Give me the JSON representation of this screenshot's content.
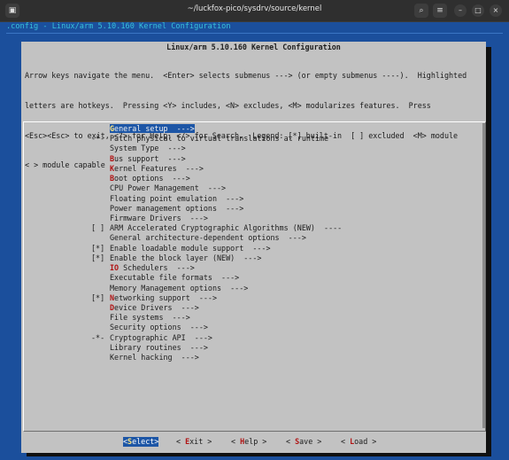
{
  "window": {
    "title": "~/luckfox-pico/sysdrv/source/kernel",
    "icons": [
      "terminal-icon",
      "search-icon",
      "menu-icon",
      "minimize-icon",
      "maximize-icon",
      "close-icon"
    ]
  },
  "terminal": {
    "config_header": ".config - Linux/arm 5.10.160 Kernel Configuration",
    "dialog_title": "Linux/arm 5.10.160 Kernel Configuration",
    "help_lines": [
      "Arrow keys navigate the menu.  <Enter> selects submenus ---> (or empty submenus ----).  Highlighted",
      "letters are hotkeys.  Pressing <Y> includes, <N> excludes, <M> modularizes features.  Press",
      "<Esc><Esc> to exit, <?> for Help, </> for Search.  Legend: [*] built-in  [ ] excluded  <M> module",
      "< > module capable"
    ],
    "menu": [
      {
        "prefix": "",
        "hotkey": "G",
        "rest": "eneral setup  --->",
        "selected": true
      },
      {
        "prefix": "-*-",
        "hotkey": "",
        "rest": "Patch physical to virtual translations at runtime"
      },
      {
        "prefix": "",
        "hotkey": "",
        "rest": "System Type  --->"
      },
      {
        "prefix": "",
        "hotkey": "B",
        "rest": "us support  --->"
      },
      {
        "prefix": "",
        "hotkey": "K",
        "rest": "ernel Features  --->"
      },
      {
        "prefix": "",
        "hotkey": "B",
        "rest": "oot options  --->"
      },
      {
        "prefix": "",
        "hotkey": "",
        "rest": "CPU Power Management  --->"
      },
      {
        "prefix": "",
        "hotkey": "",
        "rest": "Floating point emulation  --->"
      },
      {
        "prefix": "",
        "hotkey": "",
        "rest": "Power management options  --->"
      },
      {
        "prefix": "",
        "hotkey": "",
        "rest": "Firmware Drivers  --->"
      },
      {
        "prefix": "[ ]",
        "hotkey": "",
        "rest": "ARM Accelerated Cryptographic Algorithms (NEW)  ----"
      },
      {
        "prefix": "",
        "hotkey": "",
        "rest": "General architecture-dependent options  --->"
      },
      {
        "prefix": "[*]",
        "hotkey": "",
        "rest": "Enable loadable module support  --->"
      },
      {
        "prefix": "[*]",
        "hotkey": "",
        "rest": "Enable the block layer (NEW)  --->"
      },
      {
        "prefix": "",
        "hotkey": "IO",
        "rest": " Schedulers  --->"
      },
      {
        "prefix": "",
        "hotkey": "",
        "rest": "Executable file formats  --->"
      },
      {
        "prefix": "",
        "hotkey": "",
        "rest": "Memory Management options  --->"
      },
      {
        "prefix": "[*]",
        "hotkey": "N",
        "rest": "etworking support  --->"
      },
      {
        "prefix": "",
        "hotkey": "D",
        "rest": "evice Drivers  --->"
      },
      {
        "prefix": "",
        "hotkey": "",
        "rest": "File systems  --->"
      },
      {
        "prefix": "",
        "hotkey": "",
        "rest": "Security options  --->"
      },
      {
        "prefix": "-*-",
        "hotkey": "",
        "rest": "Cryptographic API  --->"
      },
      {
        "prefix": "",
        "hotkey": "",
        "rest": "Library routines  --->"
      },
      {
        "prefix": "",
        "hotkey": "",
        "rest": "Kernel hacking  --->"
      }
    ],
    "buttons": [
      {
        "pre": "<",
        "hotkey": "S",
        "post": "elect>",
        "active": true
      },
      {
        "pre": "< ",
        "hotkey": "E",
        "post": "xit >",
        "active": false
      },
      {
        "pre": "< ",
        "hotkey": "H",
        "post": "elp >",
        "active": false
      },
      {
        "pre": "< ",
        "hotkey": "S",
        "post": "ave >",
        "active": false
      },
      {
        "pre": "< ",
        "hotkey": "L",
        "post": "oad >",
        "active": false
      }
    ]
  },
  "colors": {
    "terminal_bg": "#1b4f9c",
    "dialog_bg": "#c2c2c2",
    "highlight": "#1d56a6",
    "hotkey": "#b01313"
  }
}
